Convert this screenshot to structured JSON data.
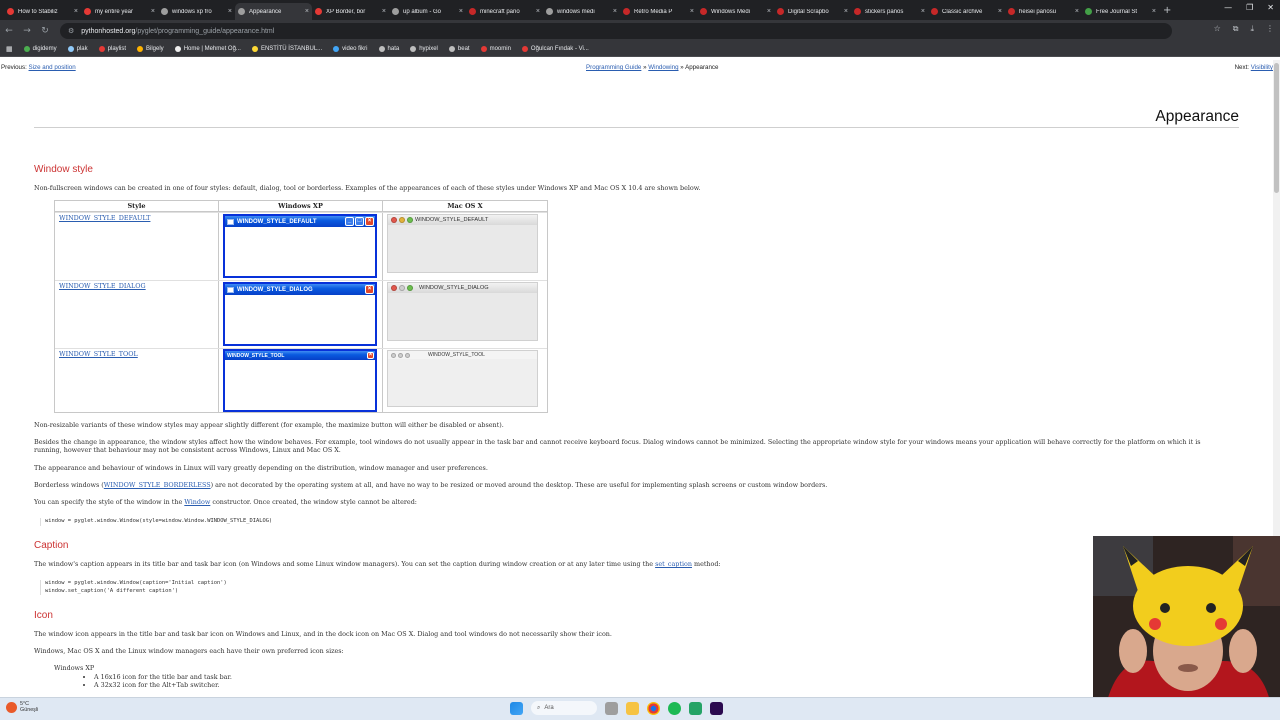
{
  "browser": {
    "tabs": [
      {
        "label": "How to Stabiliz",
        "color": "#e53935",
        "active": false
      },
      {
        "label": "my entire year",
        "color": "#e53935",
        "active": false
      },
      {
        "label": "windows xp fro",
        "color": "#9e9e9e",
        "active": false
      },
      {
        "label": "Appearance",
        "color": "#9e9e9e",
        "active": true
      },
      {
        "label": "XP Border, bor",
        "color": "#e53935",
        "active": false
      },
      {
        "label": "up album - Go",
        "color": "#9e9e9e",
        "active": false
      },
      {
        "label": "minecraft pano",
        "color": "#c62828",
        "active": false
      },
      {
        "label": "windows medi",
        "color": "#9e9e9e",
        "active": false
      },
      {
        "label": "Retro Media P",
        "color": "#c62828",
        "active": false
      },
      {
        "label": "Windows Medi",
        "color": "#c62828",
        "active": false
      },
      {
        "label": "Digital Scrapbo",
        "color": "#c62828",
        "active": false
      },
      {
        "label": "stickers panos",
        "color": "#c62828",
        "active": false
      },
      {
        "label": "Classic archive",
        "color": "#c62828",
        "active": false
      },
      {
        "label": "heisei panosu",
        "color": "#c62828",
        "active": false
      },
      {
        "label": "Free Journal St",
        "color": "#43a047",
        "active": false
      }
    ],
    "new_tab": "+",
    "url_host": "pythonhosted.org",
    "url_path": "/pyglet/programming_guide/appearance.html",
    "bookmarks": [
      {
        "label": "digidemy",
        "color": "#4caf50"
      },
      {
        "label": "plak",
        "color": "#90caf9"
      },
      {
        "label": "playlist",
        "color": "#e53935"
      },
      {
        "label": "Bilgely",
        "color": "#ffb300"
      },
      {
        "label": "Home | Mehmet Oğ...",
        "color": "#eeeeee"
      },
      {
        "label": "ENSTİTÜ İSTANBUL...",
        "color": "#fdd835"
      },
      {
        "label": "video fikri",
        "color": "#42a5f5"
      },
      {
        "label": "hata",
        "color": "#bdbdbd"
      },
      {
        "label": "hypixel",
        "color": "#bdbdbd"
      },
      {
        "label": "beat",
        "color": "#bdbdbd"
      },
      {
        "label": "moomin",
        "color": "#e53935"
      },
      {
        "label": "Oğulcan Fındak - Vi...",
        "color": "#e53935"
      }
    ]
  },
  "page": {
    "nav": {
      "prev_label": "Previous:",
      "prev_link": "Size and position",
      "crumb_1": "Programming Guide",
      "crumb_sep": " » ",
      "crumb_2": "Windowing",
      "crumb_current": "Appearance",
      "next_label": "Next:",
      "next_link": "Visibility"
    },
    "title": "Appearance",
    "window_style": {
      "heading": "Window style",
      "intro": "Non-fullscreen windows can be created in one of four styles: default, dialog, tool or borderless. Examples of the appearances of each of these styles under Windows XP and Mac OS X 10.4 are shown below.",
      "table": {
        "headers": [
          "Style",
          "Windows XP",
          "Mac OS X"
        ],
        "rows": [
          {
            "style": "WINDOW_STYLE_DEFAULT",
            "xp_title": "WINDOW_STYLE_DEFAULT",
            "mac_title": "WINDOW_STYLE_DEFAULT"
          },
          {
            "style": "WINDOW_STYLE_DIALOG",
            "xp_title": "WINDOW_STYLE_DIALOG",
            "mac_title": "WINDOW_STYLE_DIALOG"
          },
          {
            "style": "WINDOW_STYLE_TOOL",
            "xp_title": "WINDOW_STYLE_TOOL",
            "mac_title": "WINDOW_STYLE_TOOL"
          }
        ]
      },
      "p1": "Non-resizable variants of these window styles may appear slightly different (for example, the maximize button will either be disabled or absent).",
      "p2": "Besides the change in appearance, the window styles affect how the window behaves. For example, tool windows do not usually appear in the task bar and cannot receive keyboard focus. Dialog windows cannot be minimized. Selecting the appropriate window style for your windows means your application will behave correctly for the platform on which it is running, however that behaviour may not be consistent across Windows, Linux and Mac OS X.",
      "p3": "The appearance and behaviour of windows in Linux will vary greatly depending on the distribution, window manager and user preferences.",
      "p4_a": "Borderless windows (",
      "p4_link": "WINDOW_STYLE_BORDERLESS",
      "p4_b": ") are not decorated by the operating system at all, and have no way to be resized or moved around the desktop. These are useful for implementing splash screens or custom window borders.",
      "p5_a": "You can specify the style of the window in the ",
      "p5_link": "Window",
      "p5_b": " constructor. Once created, the window style cannot be altered:",
      "code": "window = pyglet.window.Window(style=window.Window.WINDOW_STYLE_DIALOG)"
    },
    "caption": {
      "heading": "Caption",
      "p_a": "The window's caption appears in its title bar and task bar icon (on Windows and some Linux window managers). You can set the caption during window creation or at any later time using the ",
      "p_link": "set_caption",
      "p_b": " method:",
      "code": "window = pyglet.window.Window(caption='Initial caption')\nwindow.set_caption('A different caption')"
    },
    "icon": {
      "heading": "Icon",
      "p1": "The window icon appears in the title bar and task bar icon on Windows and Linux, and in the dock icon on Mac OS X. Dialog and tool windows do not necessarily show their icon.",
      "p2": "Windows, Mac OS X and the Linux window managers each have their own preferred icon sizes:",
      "list_title": "Windows XP",
      "list_items": [
        "A 16x16 icon for the title bar and task bar.",
        "A 32x32 icon for the Alt+Tab switcher."
      ]
    }
  },
  "taskbar": {
    "weather_temp": "5°C",
    "weather_desc": "Güneşli",
    "search_placeholder": "Ara"
  }
}
